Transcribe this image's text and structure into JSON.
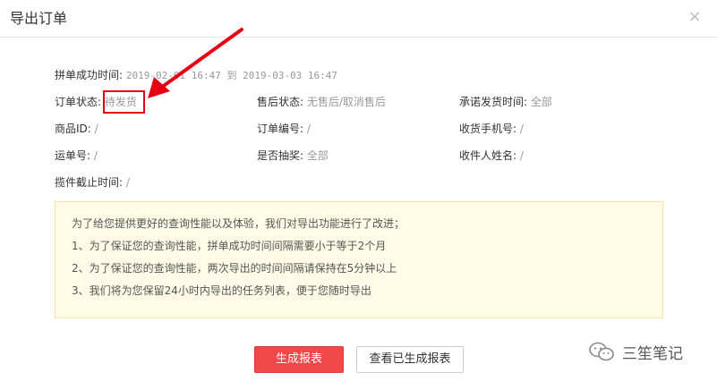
{
  "dialog": {
    "title": "导出订单",
    "close_glyph": "×"
  },
  "filters": {
    "time_range": {
      "label": "拼单成功时间:",
      "value": "2019-02-01 16:47 到 2019-03-03 16:47"
    },
    "order_status": {
      "label": "订单状态:",
      "value": "待发货"
    },
    "after_sale_status": {
      "label": "售后状态:",
      "value": "无售后/取消售后"
    },
    "promised_ship_time": {
      "label": "承诺发货时间:",
      "value": "全部"
    },
    "product_id": {
      "label": "商品ID:",
      "value": "/"
    },
    "order_number": {
      "label": "订单编号:",
      "value": "/"
    },
    "receiver_phone": {
      "label": "收货手机号:",
      "value": "/"
    },
    "tracking_number": {
      "label": "运单号:",
      "value": "/"
    },
    "lottery": {
      "label": "是否抽奖:",
      "value": "全部"
    },
    "receiver_name": {
      "label": "收件人姓名:",
      "value": "/"
    },
    "pickup_deadline": {
      "label": "揽件截止时间:",
      "value": "/"
    }
  },
  "notice": {
    "lines": [
      "为了给您提供更好的查询性能以及体验，我们对导出功能进行了改进；",
      "1、为了保证您的查询性能，拼单成功时间间隔需要小于等于2个月",
      "2、为了保证您的查询性能，两次导出的时间间隔请保持在5分钟以上",
      "3、我们将为您保留24小时内导出的任务列表，便于您随时导出"
    ]
  },
  "buttons": {
    "generate": "生成报表",
    "view_generated": "查看已生成报表"
  },
  "watermark": {
    "text": "三笙笔记",
    "icon": "wechat-icon"
  },
  "colors": {
    "primary": "#f04848",
    "highlight": "#e60012",
    "notice_bg": "#fffbe6",
    "muted_text": "#999999"
  }
}
